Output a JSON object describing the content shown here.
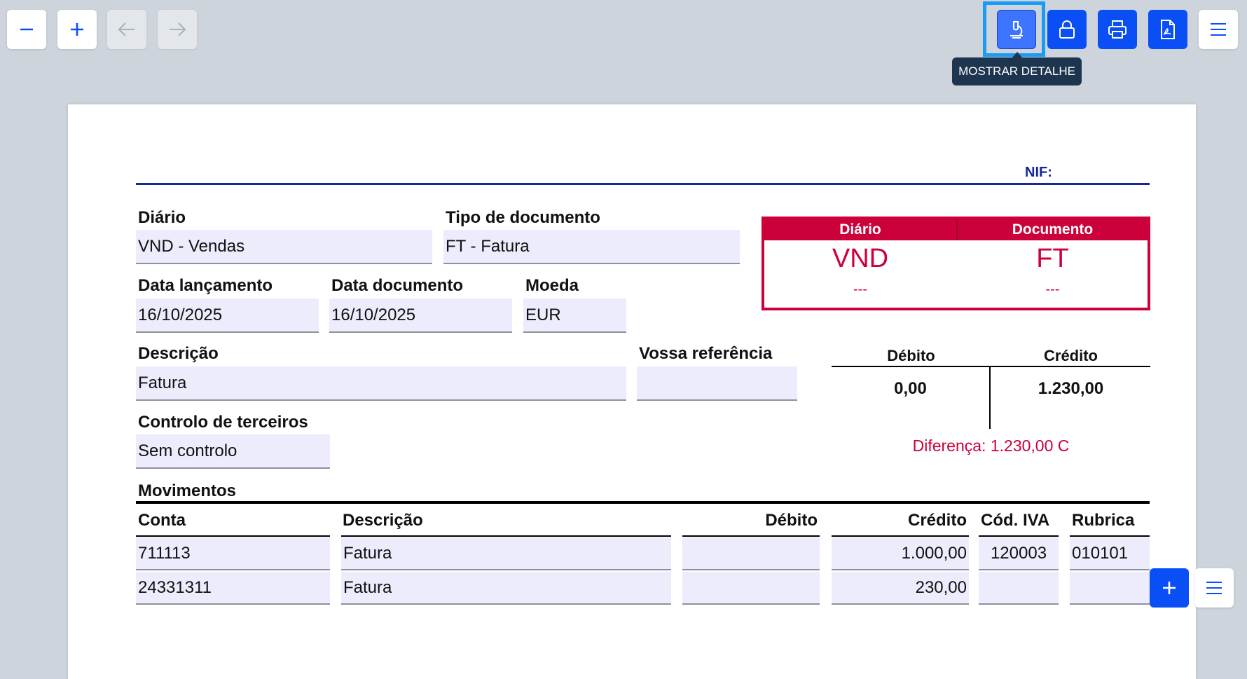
{
  "toolbar": {
    "zoom_out_icon": "minus-icon",
    "zoom_in_icon": "plus-icon",
    "back_icon": "arrow-left-icon",
    "forward_icon": "arrow-right-icon",
    "detail_icon": "microscope-icon",
    "lock_icon": "lock-icon",
    "print_icon": "printer-icon",
    "pdf_icon": "pdf-file-icon",
    "menu_icon": "hamburger-menu-icon",
    "tooltip": "MOSTRAR DETALHE"
  },
  "header": {
    "nif_label": "NIF:"
  },
  "form": {
    "diario_label": "Diário",
    "diario_value": "VND - Vendas",
    "tipo_label": "Tipo de documento",
    "tipo_value": "FT - Fatura",
    "data_lanc_label": "Data lançamento",
    "data_lanc_value": "16/10/2025",
    "data_doc_label": "Data documento",
    "data_doc_value": "16/10/2025",
    "moeda_label": "Moeda",
    "moeda_value": "EUR",
    "descricao_label": "Descrição",
    "descricao_value": "Fatura",
    "vossa_ref_label": "Vossa referência",
    "vossa_ref_value": "",
    "controlo_label": "Controlo de terceiros",
    "controlo_value": "Sem controlo"
  },
  "summary_box": {
    "diario_header": "Diário",
    "documento_header": "Documento",
    "diario_code": "VND",
    "documento_code": "FT",
    "diario_number": "---",
    "documento_number": "---"
  },
  "totals": {
    "debito_label": "Débito",
    "credito_label": "Crédito",
    "debito_value": "0,00",
    "credito_value": "1.230,00",
    "diferenca": "Diferença: 1.230,00 C"
  },
  "movimentos": {
    "title": "Movimentos",
    "columns": [
      "Conta",
      "Descrição",
      "Débito",
      "Crédito",
      "Cód. IVA",
      "Rubrica"
    ],
    "rows": [
      {
        "conta": "711113",
        "descricao": "Fatura",
        "debito": "",
        "credito": "1.000,00",
        "cod_iva": "120003",
        "rubrica": "010101"
      },
      {
        "conta": "24331311",
        "descricao": "Fatura",
        "debito": "",
        "credito": "230,00",
        "cod_iva": "",
        "rubrica": ""
      }
    ],
    "add_row_icon": "plus-icon",
    "row_menu_icon": "hamburger-menu-icon"
  },
  "colors": {
    "accent_blue": "#0a4ff5",
    "brand_red": "#cc003a",
    "field_bg": "#ececfc",
    "page_bg": "#cdd4db",
    "tooltip_bg": "#1e3550"
  }
}
